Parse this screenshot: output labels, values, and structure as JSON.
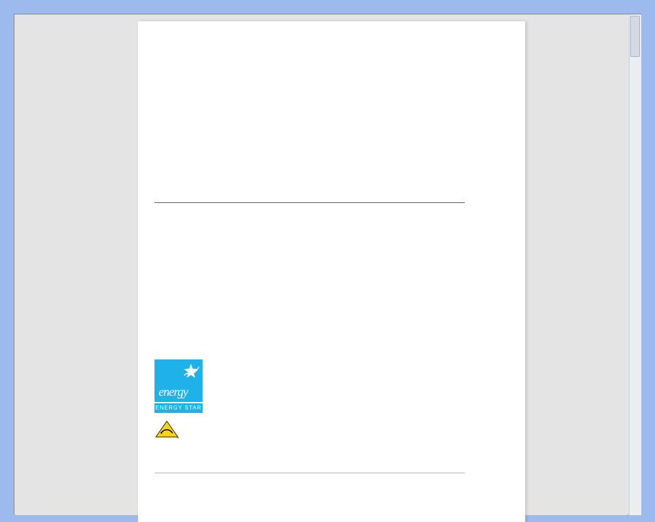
{
  "logos": {
    "energy_star": {
      "script_text": "energy",
      "label": "ENERGY STAR"
    }
  },
  "icons": {
    "warning": "warning-triangle"
  }
}
